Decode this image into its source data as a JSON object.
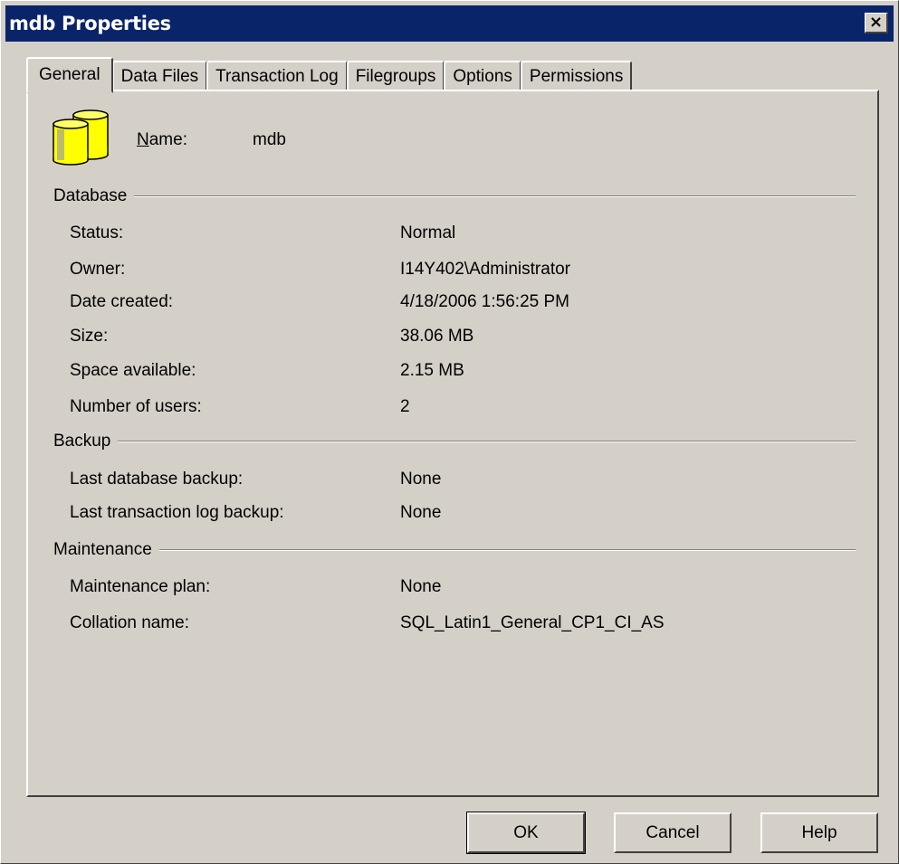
{
  "window": {
    "title": "mdb Properties",
    "close_glyph": "×"
  },
  "tabs": [
    {
      "label": "General",
      "active": true
    },
    {
      "label": "Data Files",
      "active": false
    },
    {
      "label": "Transaction Log",
      "active": false
    },
    {
      "label": "Filegroups",
      "active": false
    },
    {
      "label": "Options",
      "active": false
    },
    {
      "label": "Permissions",
      "active": false
    }
  ],
  "general": {
    "name_label_accel": "N",
    "name_label_rest": "ame:",
    "name_value": "mdb",
    "database": {
      "header": "Database",
      "status_label": "Status:",
      "status_value": "Normal",
      "owner_label": "Owner:",
      "owner_value": "I14Y402\\Administrator",
      "created_label": "Date created:",
      "created_value": "4/18/2006 1:56:25 PM",
      "size_label": "Size:",
      "size_value": "38.06 MB",
      "space_label": "Space available:",
      "space_value": "2.15 MB",
      "users_label": "Number of users:",
      "users_value": "2"
    },
    "backup": {
      "header": "Backup",
      "last_db_label": "Last database backup:",
      "last_db_value": "None",
      "last_log_label": "Last transaction log backup:",
      "last_log_value": "None"
    },
    "maintenance": {
      "header": "Maintenance",
      "plan_label": "Maintenance plan:",
      "plan_value": "None",
      "collation_label": "Collation name:",
      "collation_value": "SQL_Latin1_General_CP1_CI_AS"
    }
  },
  "buttons": {
    "ok": "OK",
    "cancel": "Cancel",
    "help": "Help"
  },
  "icon": {
    "name": "database-icon",
    "color": "#ffff00"
  }
}
